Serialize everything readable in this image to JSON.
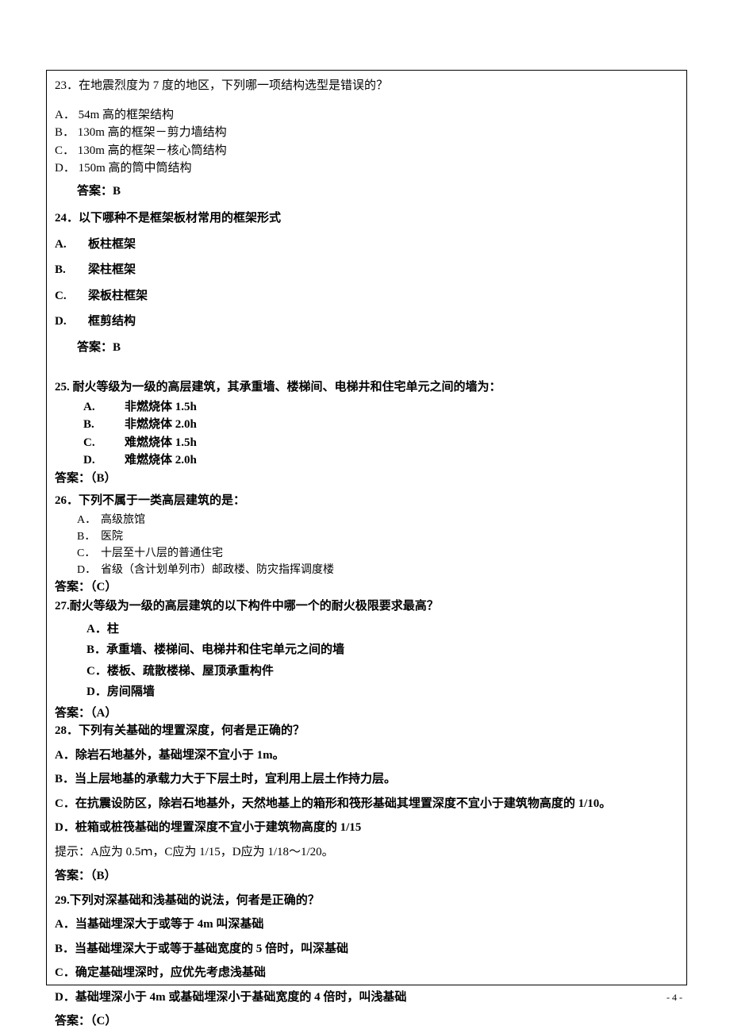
{
  "q23": {
    "title": "23．在地震烈度为 7 度的地区，下列哪一项结构选型是错误的？",
    "a": "A．  54m 高的框架结构",
    "b": "B．  130m 高的框架－剪力墙结构",
    "c": "C．  130m 高的框架－核心筒结构",
    "d": "D．  150m 高的筒中筒结构",
    "ans": "答案：B"
  },
  "q24": {
    "title": "24．以下哪种不是框架板材常用的框架形式",
    "a_l": "A.",
    "a_t": "板柱框架",
    "b_l": "B.",
    "b_t": "梁柱框架",
    "c_l": "C.",
    "c_t": "梁板柱框架",
    "d_l": "D.",
    "d_t": "框剪结构",
    "ans": "答案：B"
  },
  "q25": {
    "title": "25. 耐火等级为一级的高层建筑，其承重墙、楼梯间、电梯井和住宅单元之间的墙为：",
    "a_l": "A.",
    "a_t": "非燃烧体 1.5h",
    "b_l": "B.",
    "b_t": "非燃烧体 2.0h",
    "c_l": "C.",
    "c_t": "难燃烧体 1.5h",
    "d_l": "D.",
    "d_t": "难燃烧体 2.0h",
    "ans": "答案：（B）"
  },
  "q26": {
    "title": "26．下列不属于一类高层建筑的是：",
    "a_l": "A．",
    "a_t": "高级旅馆",
    "b_l": "B．",
    "b_t": "医院",
    "c_l": "C．",
    "c_t": "十层至十八层的普通住宅",
    "d_l": "D．",
    "d_t": "省级（含计划单列市）邮政楼、防灾指挥调度楼",
    "ans": "答案：（C）"
  },
  "q27": {
    "title": "27.耐火等级为一级的高层建筑的以下构件中哪一个的耐火极限要求最高？",
    "a": "A．柱",
    "b": "B．承重墙、楼梯间、电梯井和住宅单元之间的墙",
    "c": "C．楼板、疏散楼梯、屋顶承重构件",
    "d": "D．房间隔墙",
    "ans": "答案：（A）"
  },
  "q28": {
    "title": "28．下列有关基础的埋置深度，何者是正确的？",
    "a": "A．除岩石地基外，基础埋深不宜小于 1m。",
    "b": "B．当上层地基的承载力大于下层土时，宜利用上层土作持力层。",
    "c": "C．在抗震设防区，除岩石地基外，天然地基上的箱形和筏形基础其埋置深度不宜小于建筑物高度的 1/10。",
    "d": "D．桩箱或桩筏基础的埋置深度不宜小于建筑物高度的 1/15",
    "hint": "提示：A应为 0.5ｍ，C应为 1/15，D应为 1/18～1/20。",
    "ans": "答案：（B）"
  },
  "q29": {
    "title": "29.下列对深基础和浅基础的说法，何者是正确的？",
    "a": "A．当基础埋深大于或等于 4m 叫深基础",
    "b": "B．当基础埋深大于或等于基础宽度的 5 倍时，叫深基础",
    "c": "C．确定基础埋深时，应优先考虑浅基础",
    "d": "D．基础埋深小于 4m 或基础埋深小于基础宽度的 4 倍时，叫浅基础",
    "ans": "答案：（C）"
  },
  "pageNum": "- 4 -"
}
